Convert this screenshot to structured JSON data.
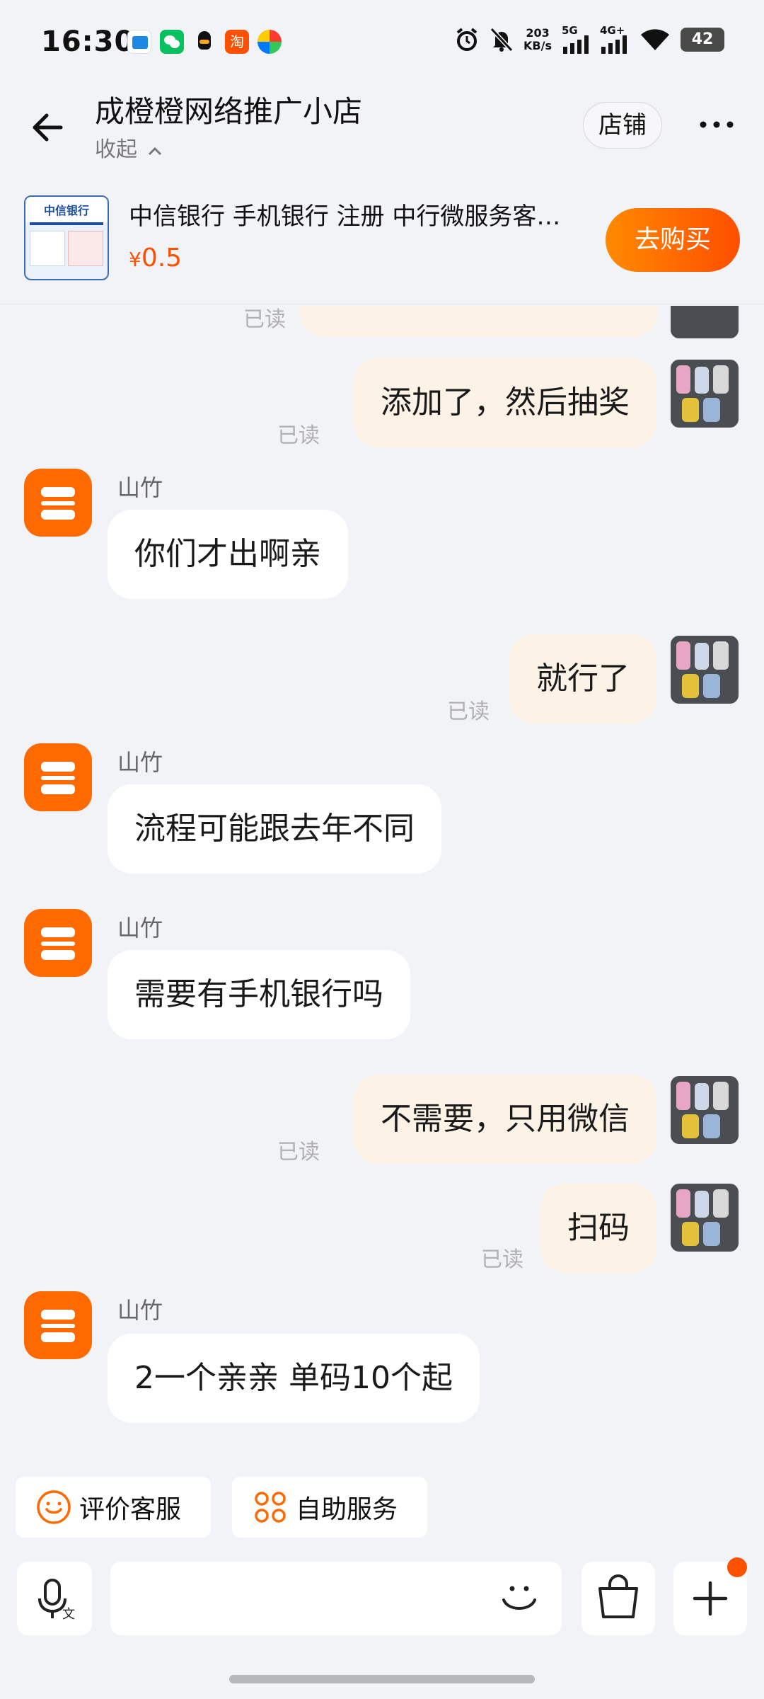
{
  "status_bar": {
    "time": "16:30",
    "net_speed_value": "203",
    "net_speed_unit": "KB/s",
    "signal_1": "5G",
    "signal_2": "4G+",
    "battery": "42"
  },
  "header": {
    "shop_name": "成橙橙网络推广小店",
    "collapse_label": "收起",
    "shop_button": "店铺"
  },
  "product": {
    "title": "中信银行 手机银行 注册 中行微服务客…",
    "currency": "¥",
    "price": "0.5",
    "buy_button": "去购买",
    "thumb_text": "中信银行"
  },
  "messages": [
    {
      "side": "me",
      "text": "添加了，然后抽奖",
      "read": "已读"
    },
    {
      "side": "shop",
      "sender": "山竹",
      "text": "你们才出啊亲"
    },
    {
      "side": "me",
      "text": "就行了",
      "read": "已读"
    },
    {
      "side": "shop",
      "sender": "山竹",
      "text": "流程可能跟去年不同"
    },
    {
      "side": "shop",
      "sender": "山竹",
      "text": "需要有手机银行吗"
    },
    {
      "side": "me",
      "text": "不需要，只用微信",
      "read": "已读"
    },
    {
      "side": "me",
      "text": "扫码",
      "read": "已读"
    },
    {
      "side": "shop",
      "sender": "山竹",
      "text": "2一个亲亲 单码10个起"
    }
  ],
  "partial_top_read": "已读",
  "quick_actions": {
    "rate_service": "评价客服",
    "self_service": "自助服务"
  },
  "icons": {
    "back": "back-arrow-icon",
    "more": "more-dots-icon",
    "voice": "voice-to-text-icon",
    "emoji": "emoji-icon",
    "bag": "shopping-bag-icon",
    "plus": "plus-icon"
  },
  "colors": {
    "accent": "#ff5000",
    "buy_gradient_start": "#ff8a00",
    "buy_gradient_end": "#ff4e00",
    "my_bubble": "#fdf2e6",
    "shop_bubble": "#ffffff",
    "background": "#f2f3f7"
  }
}
